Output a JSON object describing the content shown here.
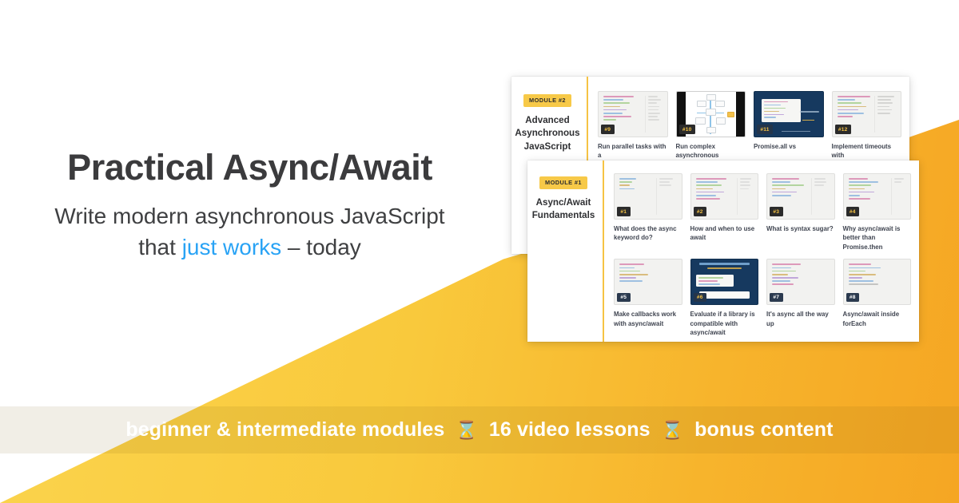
{
  "theme": {
    "yellow_light": "#FBD54F",
    "yellow": "#F7C948",
    "orange": "#F5A623",
    "accent_blue": "#29A3F5",
    "text_dark": "#3b3b3d",
    "navy": "#16395f",
    "badge_navy": "#2b3a4f"
  },
  "hero": {
    "headline": "Practical Async/Await",
    "subhead_line1": "Write modern asynchronous JavaScript",
    "subhead_line2_pre": "that ",
    "subhead_line2_highlight": "just works",
    "subhead_line2_post": " – today"
  },
  "banner": {
    "item1": "beginner & intermediate modules",
    "separator1": "⌛",
    "item2": "16 video lessons",
    "separator2": "⌛",
    "item3": "bonus content"
  },
  "cards": [
    {
      "badge": "MODULE #2",
      "title_line1": "Advanced",
      "title_line2": "Asynchronous",
      "title_line3": "JavaScript",
      "rows": [
        [
          {
            "number": "#9",
            "caption": "Run parallel tasks with a",
            "style": "code",
            "badge_style": "gold"
          },
          {
            "number": "#10",
            "caption": "Run complex asynchronous",
            "style": "diagram",
            "badge_style": "gold"
          },
          {
            "number": "#11",
            "caption": "Promise.all vs",
            "style": "dark",
            "badge_style": "gold"
          },
          {
            "number": "#12",
            "caption": "Implement timeouts with",
            "style": "code",
            "badge_style": "gold"
          }
        ]
      ]
    },
    {
      "badge": "MODULE #1",
      "title_line1": "Async/Await",
      "title_line2": "Fundamentals",
      "title_line3": "",
      "rows": [
        [
          {
            "number": "#1",
            "caption": "What does the async keyword do?",
            "style": "code",
            "badge_style": "gold"
          },
          {
            "number": "#2",
            "caption": "How and when to use await",
            "style": "code",
            "badge_style": "gold"
          },
          {
            "number": "#3",
            "caption": "What is syntax sugar?",
            "style": "code",
            "badge_style": "gold"
          },
          {
            "number": "#4",
            "caption": "Why async/await is better than Promise.then",
            "style": "code",
            "badge_style": "gold"
          }
        ],
        [
          {
            "number": "#5",
            "caption": "Make callbacks work with async/await",
            "style": "code",
            "badge_style": "navy"
          },
          {
            "number": "#6",
            "caption": "Evaluate if a library is compatible with async/await",
            "style": "dark",
            "badge_style": "gold"
          },
          {
            "number": "#7",
            "caption": "It's async all the way up",
            "style": "code",
            "badge_style": "navy"
          },
          {
            "number": "#8",
            "caption": "Async/await inside forEach",
            "style": "code",
            "badge_style": "navy"
          }
        ]
      ]
    }
  ]
}
